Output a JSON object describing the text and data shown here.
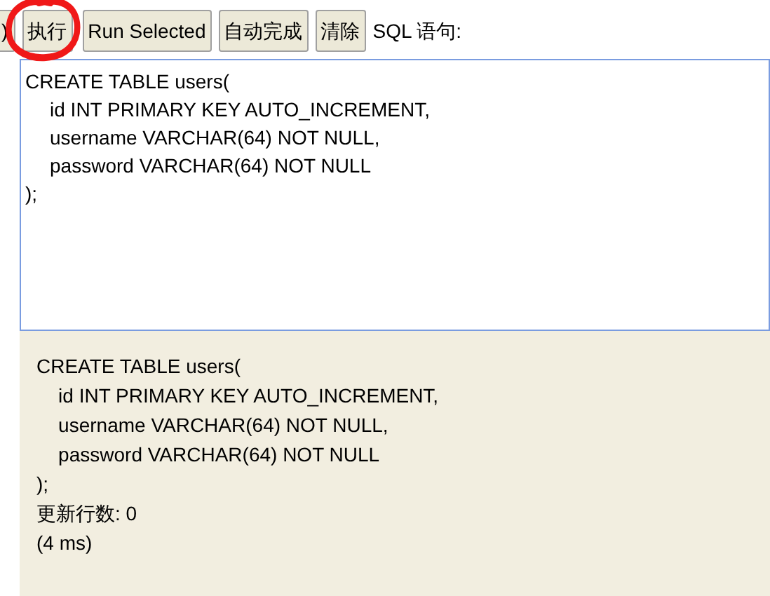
{
  "toolbar": {
    "buttons": [
      {
        "label": ")",
        "kind": "clipped"
      },
      {
        "label": "执行",
        "kind": "normal"
      },
      {
        "label": "Run Selected",
        "kind": "normal"
      },
      {
        "label": "自动完成",
        "kind": "normal"
      },
      {
        "label": "清除",
        "kind": "normal"
      }
    ],
    "label": "SQL 语句:"
  },
  "editor": {
    "lines": [
      "CREATE TABLE users(",
      "\tid INT PRIMARY KEY AUTO_INCREMENT,",
      "\tusername VARCHAR(64) NOT NULL,",
      "\tpassword VARCHAR(64) NOT NULL",
      ");"
    ]
  },
  "result": {
    "lines": [
      "CREATE TABLE users(",
      "    id INT PRIMARY KEY AUTO_INCREMENT,",
      "    username VARCHAR(64) NOT NULL,",
      "    password VARCHAR(64) NOT NULL",
      ");",
      "更新行数: 0",
      "(4 ms)"
    ]
  }
}
